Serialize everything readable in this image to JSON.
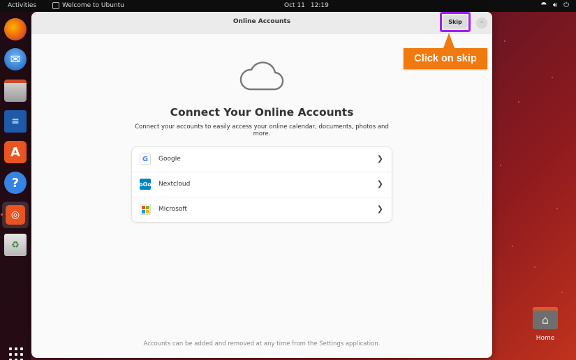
{
  "topbar": {
    "activities": "Activities",
    "app_name": "Welcome to Ubuntu",
    "date": "Oct 11",
    "time": "12:19",
    "tray_icons": [
      "network-icon",
      "volume-icon",
      "power-icon"
    ]
  },
  "dock": {
    "items": [
      {
        "name": "firefox-icon"
      },
      {
        "name": "thunderbird-icon"
      },
      {
        "name": "files-icon"
      },
      {
        "name": "writer-icon"
      },
      {
        "name": "app-center-icon"
      },
      {
        "name": "help-icon"
      },
      {
        "name": "ubuntu-welcome-icon",
        "active": true
      },
      {
        "name": "trash-icon"
      }
    ],
    "show_apps_icon": "grid-icon"
  },
  "desktop": {
    "home_label": "Home"
  },
  "window": {
    "title": "Online Accounts",
    "skip_label": "Skip",
    "minimize_glyph": "–",
    "heading": "Connect Your Online Accounts",
    "subtitle": "Connect your accounts to easily access your online calendar, documents, photos and more.",
    "accounts": [
      {
        "label": "Google",
        "icon": "google-icon"
      },
      {
        "label": "Nextcloud",
        "icon": "nextcloud-icon"
      },
      {
        "label": "Microsoft",
        "icon": "microsoft-icon"
      }
    ],
    "footer": "Accounts can be added and removed at any time from the Settings application."
  },
  "annotation": {
    "text": "Click on skip",
    "color": "#f07a10",
    "highlight_color": "#a020f0"
  }
}
